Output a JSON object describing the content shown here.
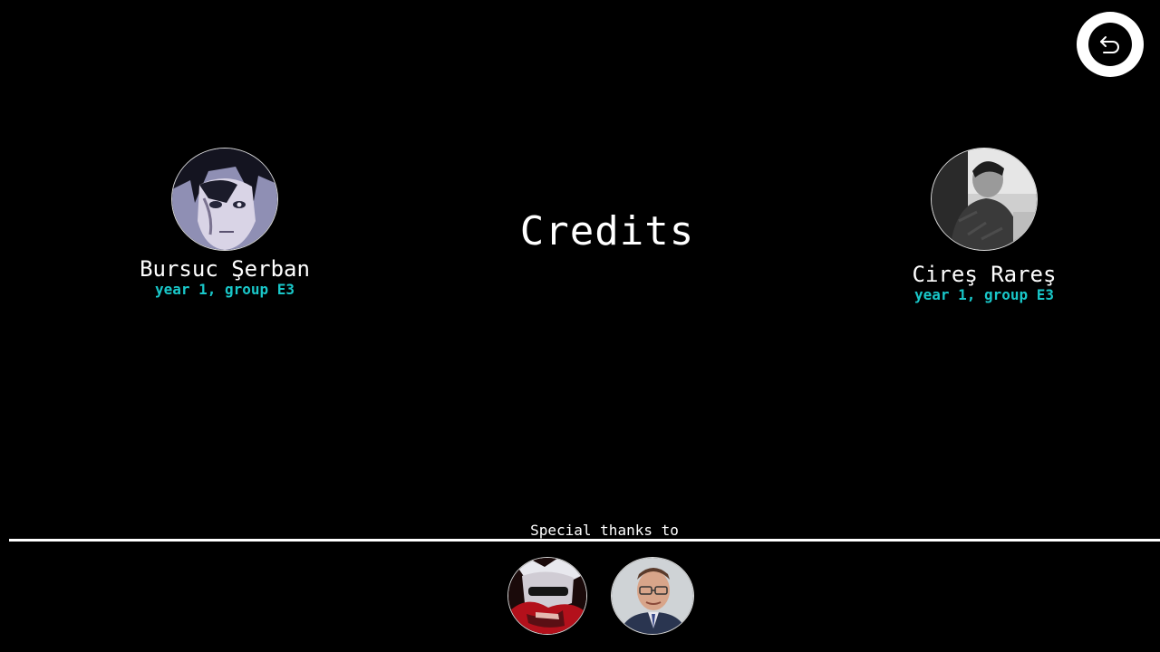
{
  "screen": {
    "title": "Credits",
    "background": "#000000",
    "accent": "#19c7c9"
  },
  "back_button": {
    "icon": "undo-arrow-icon"
  },
  "authors": [
    {
      "name": "Bursuc Şerban",
      "subtitle": "year 1, group E3",
      "avatar": "anime-character-portrait"
    },
    {
      "name": "Cireş Rareş",
      "subtitle": "year 1, group E3",
      "avatar": "grayscale-photo-portrait"
    }
  ],
  "special_thanks": {
    "label": "Special thanks to",
    "people": [
      {
        "avatar": "masked-anime-character-portrait"
      },
      {
        "avatar": "man-with-glasses-portrait"
      }
    ]
  }
}
